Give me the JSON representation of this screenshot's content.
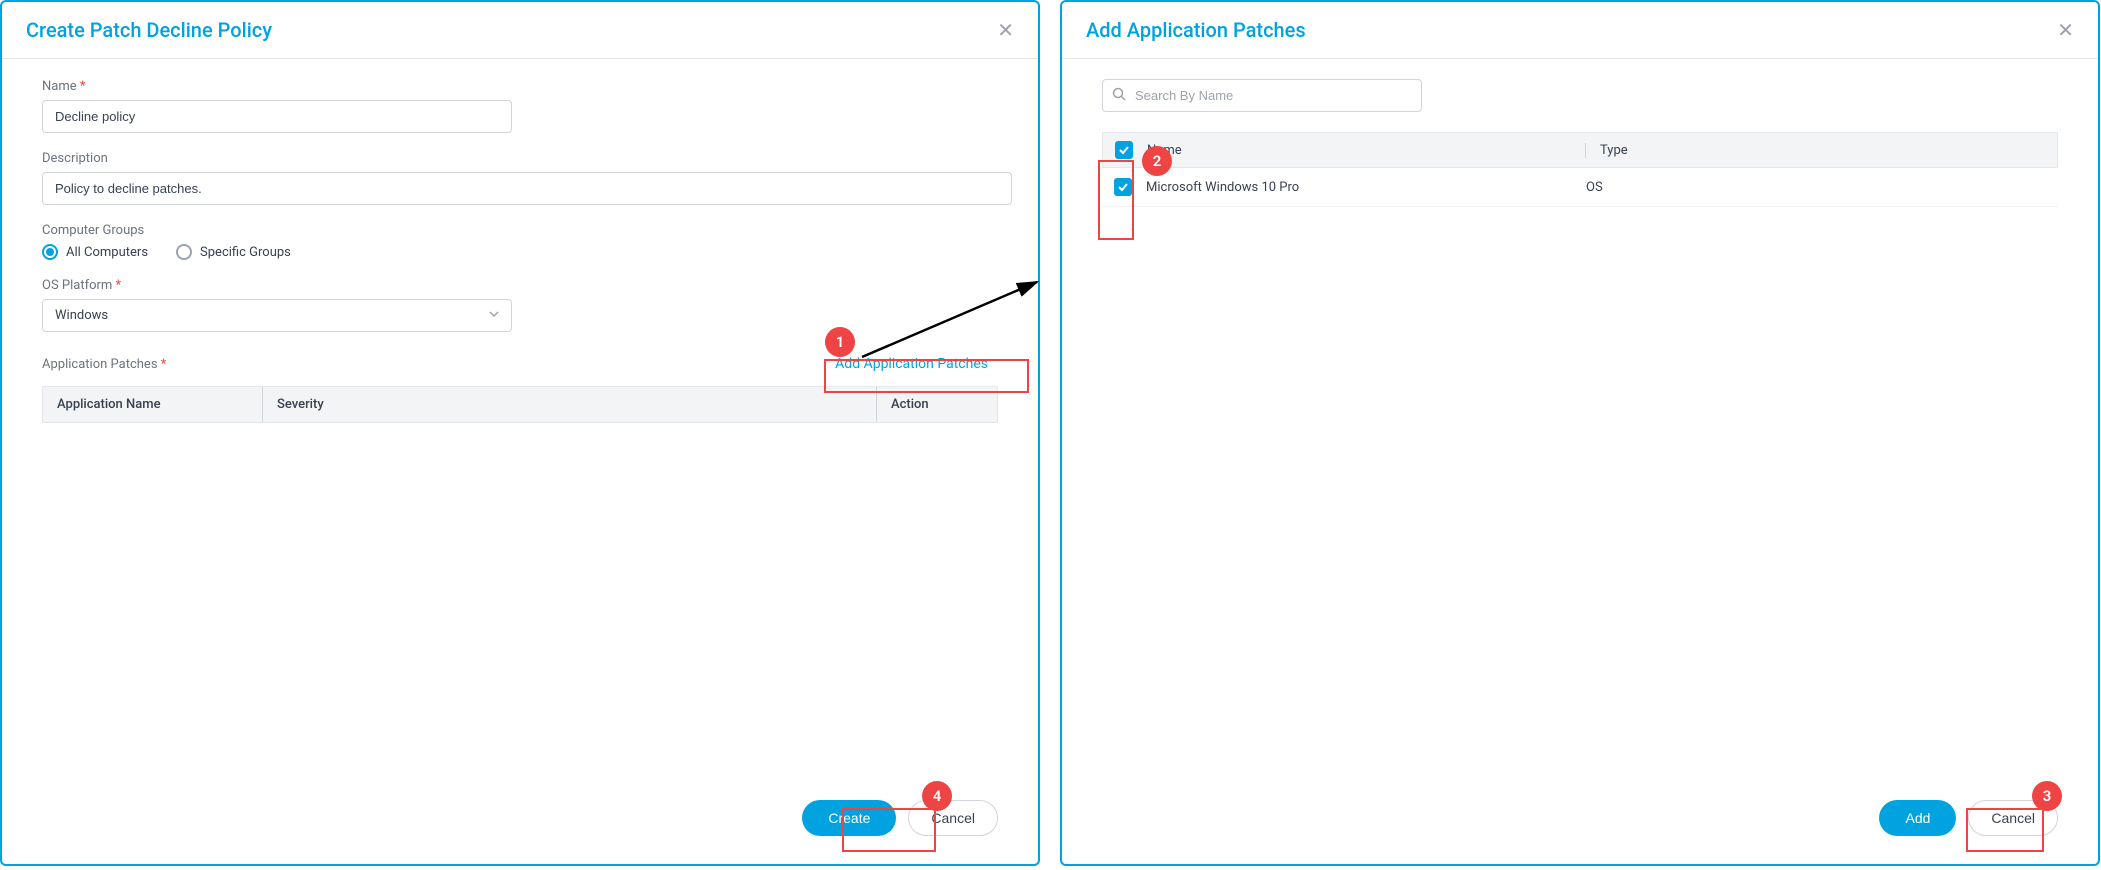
{
  "left": {
    "title": "Create Patch Decline Policy",
    "name_label": "Name",
    "name_value": "Decline policy",
    "description_label": "Description",
    "description_value": "Policy to decline patches.",
    "groups_label": "Computer Groups",
    "groups_options": {
      "all": "All Computers",
      "specific": "Specific Groups"
    },
    "os_label": "OS Platform",
    "os_value": "Windows",
    "app_patches_label": "Application Patches",
    "add_app_patches_link": "Add Application Patches",
    "table": {
      "app_name": "Application Name",
      "severity": "Severity",
      "action": "Action"
    },
    "buttons": {
      "create": "Create",
      "cancel": "Cancel"
    }
  },
  "right": {
    "title": "Add Application Patches",
    "search_placeholder": "Search By Name",
    "table_headers": {
      "name": "Name",
      "type": "Type"
    },
    "rows": [
      {
        "name": "Microsoft Windows 10 Pro",
        "type": "OS",
        "checked": true
      }
    ],
    "buttons": {
      "add": "Add",
      "cancel": "Cancel"
    }
  },
  "callouts": {
    "c1": "1",
    "c2": "2",
    "c3": "3",
    "c4": "4"
  }
}
